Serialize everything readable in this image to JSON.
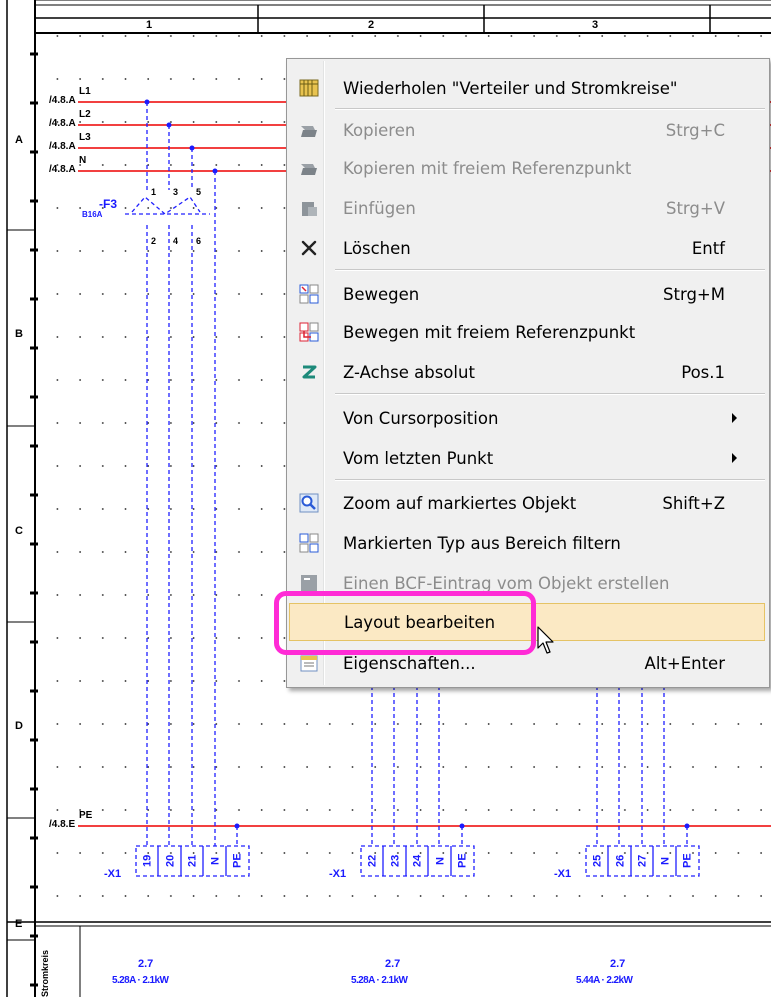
{
  "columns": [
    "1",
    "2",
    "3"
  ],
  "rows": [
    "A",
    "B",
    "C",
    "D",
    "E"
  ],
  "wires": {
    "l1_ref": "/4.8.A",
    "l1_label": "L1",
    "l2_ref": "/4.8.A",
    "l2_label": "L2",
    "l3_ref": "/4.8.A",
    "l3_label": "L3",
    "n_ref": "/4.8.A",
    "n_label": "N",
    "pe_ref": "/4.8.E",
    "pe_label": "PE"
  },
  "breaker": {
    "name": "-F3",
    "rating": "B16A",
    "top_pins": [
      "1",
      "3",
      "5"
    ],
    "bottom_pins": [
      "2",
      "4",
      "6"
    ]
  },
  "terminals": [
    {
      "name": "-X1",
      "pins": [
        "19",
        "20",
        "21",
        "N",
        "PE"
      ]
    },
    {
      "name": "-X1",
      "pins": [
        "22",
        "23",
        "24",
        "N",
        "PE"
      ]
    },
    {
      "name": "-X1",
      "pins": [
        "25",
        "26",
        "27",
        "N",
        "PE"
      ]
    }
  ],
  "table": {
    "header": "Stromkreis",
    "circuits": [
      {
        "ref": "2.7",
        "value": "5.28A · 2.1kW"
      },
      {
        "ref": "2.7",
        "value": "5.28A · 2.1kW"
      },
      {
        "ref": "2.7",
        "value": "5.44A · 2.2kW"
      }
    ]
  },
  "colors": {
    "wire": "#ee0000",
    "dashed": "#2020ff",
    "highlight": "#ff2bd6"
  },
  "menu": {
    "repeat": {
      "label": "Wiederholen \"Verteiler und Stromkreise\"",
      "icon": "table-icon"
    },
    "copy": {
      "label": "Kopieren",
      "shortcut": "Strg+C",
      "icon": "copy-icon"
    },
    "copy_ref": {
      "label": "Kopieren mit freiem Referenzpunkt",
      "icon": "copy-ref-icon"
    },
    "paste": {
      "label": "Einfügen",
      "shortcut": "Strg+V",
      "icon": "paste-icon"
    },
    "delete": {
      "label": "Löschen",
      "shortcut": "Entf",
      "icon": "delete-x-icon"
    },
    "move": {
      "label": "Bewegen",
      "shortcut": "Strg+M",
      "icon": "move-icon"
    },
    "move_ref": {
      "label": "Bewegen mit freiem Referenzpunkt",
      "icon": "move-ref-icon"
    },
    "z_axis": {
      "label": "Z-Achse absolut",
      "shortcut": "Pos.1",
      "icon": "z-axis-icon"
    },
    "from_cursor": {
      "label": "Von Cursorposition"
    },
    "from_last": {
      "label": "Vom letzten Punkt"
    },
    "zoom": {
      "label": "Zoom auf markiertes Objekt",
      "shortcut": "Shift+Z",
      "icon": "zoom-icon"
    },
    "filter": {
      "label": "Markierten Typ aus Bereich filtern",
      "icon": "filter-icon"
    },
    "bcf": {
      "label": "Einen BCF-Eintrag vom Objekt erstellen",
      "icon": "bcf-icon"
    },
    "layout": {
      "label": "Layout bearbeiten"
    },
    "properties": {
      "label": "Eigenschaften...",
      "shortcut": "Alt+Enter",
      "icon": "properties-icon"
    }
  }
}
